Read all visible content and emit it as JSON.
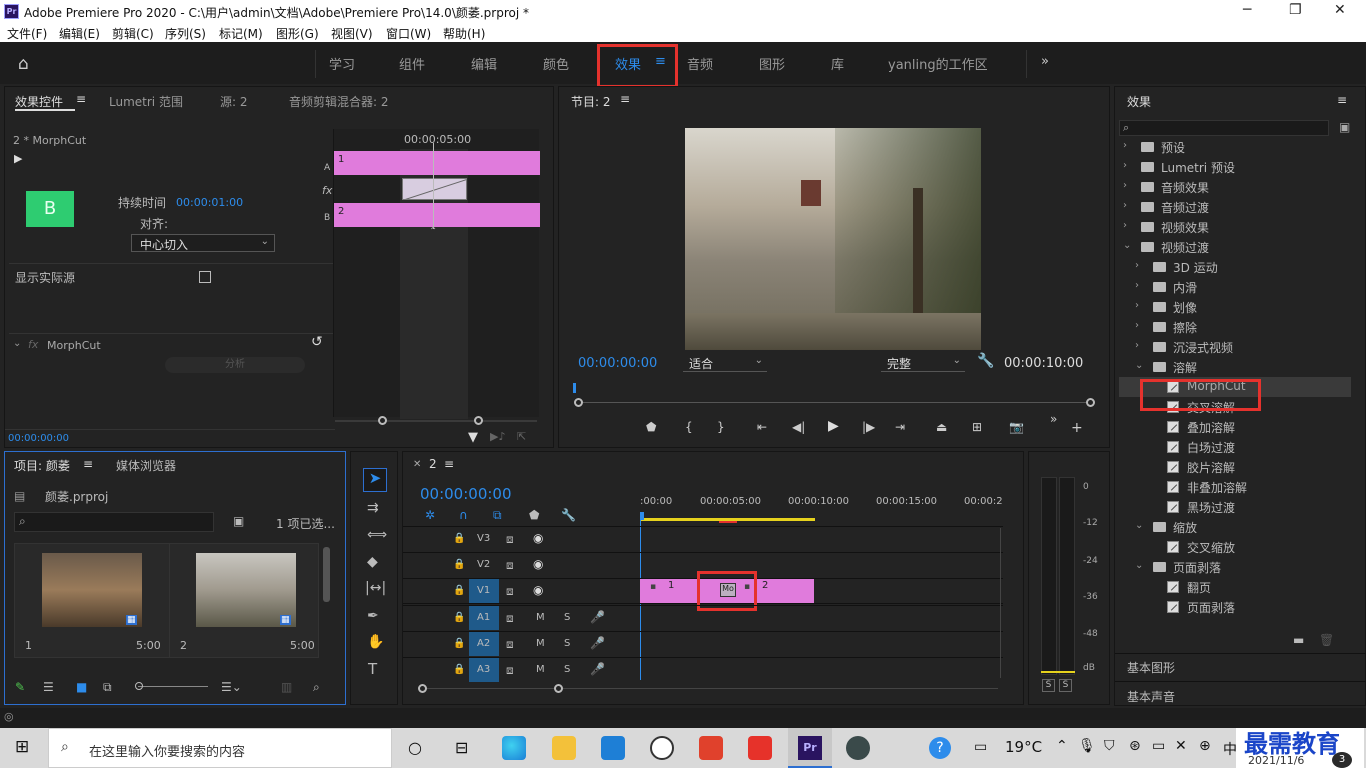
{
  "window": {
    "title": "Adobe Premiere Pro 2020 - C:\\用户\\admin\\文档\\Adobe\\Premiere Pro\\14.0\\颜萎.prproj *",
    "logo": "Pr"
  },
  "menu": [
    "文件(F)",
    "编辑(E)",
    "剪辑(C)",
    "序列(S)",
    "标记(M)",
    "图形(G)",
    "视图(V)",
    "窗口(W)",
    "帮助(H)"
  ],
  "workspaces": [
    "学习",
    "组件",
    "编辑",
    "颜色",
    "效果",
    "音频",
    "图形",
    "库",
    "yanling的工作区"
  ],
  "effect_controls": {
    "tabs": [
      "效果控件",
      "Lumetri 范围",
      "源: 2",
      "音频剪辑混合器: 2"
    ],
    "clip": "2 * MorphCut",
    "timecode_ruler": "00:00:05:00",
    "duration_label": "持续时间",
    "duration_value": "00:00:01:00",
    "align_label": "对齐:",
    "align_value": "中心切入",
    "show_source": "显示实际源",
    "effect_name": "MorphCut",
    "analyze": "分析",
    "track_a": "A",
    "track_b": "B",
    "clip_1": "1",
    "clip_2": "2",
    "fx": "fx",
    "current_time": "00:00:00:00",
    "thumb_letter": "B"
  },
  "program": {
    "title": "节目: 2",
    "timecode": "00:00:00:00",
    "fit": "适合",
    "quality": "完整",
    "duration": "00:00:10:00"
  },
  "effects_panel": {
    "title": "效果",
    "tree": [
      {
        "label": "预设",
        "level": 0,
        "type": "folder",
        "open": false
      },
      {
        "label": "Lumetri 预设",
        "level": 0,
        "type": "folder",
        "open": false
      },
      {
        "label": "音频效果",
        "level": 0,
        "type": "folder",
        "open": false
      },
      {
        "label": "音频过渡",
        "level": 0,
        "type": "folder",
        "open": false
      },
      {
        "label": "视频效果",
        "level": 0,
        "type": "folder",
        "open": false
      },
      {
        "label": "视频过渡",
        "level": 0,
        "type": "folder",
        "open": true
      },
      {
        "label": "3D 运动",
        "level": 1,
        "type": "folder",
        "open": false
      },
      {
        "label": "内滑",
        "level": 1,
        "type": "folder",
        "open": false
      },
      {
        "label": "划像",
        "level": 1,
        "type": "folder",
        "open": false
      },
      {
        "label": "擦除",
        "level": 1,
        "type": "folder",
        "open": false
      },
      {
        "label": "沉浸式视频",
        "level": 1,
        "type": "folder",
        "open": false
      },
      {
        "label": "溶解",
        "level": 1,
        "type": "folder",
        "open": true
      },
      {
        "label": "MorphCut",
        "level": 2,
        "type": "item",
        "selected": true
      },
      {
        "label": "交叉溶解",
        "level": 2,
        "type": "item"
      },
      {
        "label": "叠加溶解",
        "level": 2,
        "type": "item"
      },
      {
        "label": "白场过渡",
        "level": 2,
        "type": "item"
      },
      {
        "label": "胶片溶解",
        "level": 2,
        "type": "item"
      },
      {
        "label": "非叠加溶解",
        "level": 2,
        "type": "item"
      },
      {
        "label": "黑场过渡",
        "level": 2,
        "type": "item"
      },
      {
        "label": "缩放",
        "level": 1,
        "type": "folder",
        "open": true
      },
      {
        "label": "交叉缩放",
        "level": 2,
        "type": "item"
      },
      {
        "label": "页面剥落",
        "level": 1,
        "type": "folder",
        "open": true
      },
      {
        "label": "翻页",
        "level": 2,
        "type": "item"
      },
      {
        "label": "页面剥落",
        "level": 2,
        "type": "item"
      }
    ],
    "basic_graphics": "基本图形",
    "basic_sound": "基本声音"
  },
  "project": {
    "tabs": [
      "项目: 颜萎",
      "媒体浏览器"
    ],
    "file": "颜萎.prproj",
    "selection": "1 项已选...",
    "items": [
      {
        "name": "1",
        "duration": "5:00"
      },
      {
        "name": "2",
        "duration": "5:00"
      }
    ]
  },
  "timeline": {
    "tab": "2",
    "timecode": "00:00:00:00",
    "ruler": [
      ":00:00",
      "00:00:05:00",
      "00:00:10:00",
      "00:00:15:00",
      "00:00:2"
    ],
    "video_tracks": [
      "V3",
      "V2",
      "V1"
    ],
    "audio_tracks": [
      "A1",
      "A2",
      "A3"
    ],
    "clip1": "1",
    "clip2": "2",
    "transition": "Mo",
    "m": "M",
    "s": "S"
  },
  "meter": {
    "labels": [
      "0",
      "-12",
      "-24",
      "-36",
      "-48",
      "dB"
    ],
    "solo": "S"
  },
  "taskbar": {
    "search": "在这里输入你要搜索的内容",
    "weather": "19°C",
    "ime": "中",
    "date": "2021/11/6",
    "badge": "3",
    "watermark": "最需教育"
  },
  "colors": {
    "accent": "#2d8ceb",
    "clip": "#e07bdc",
    "highlight": "#e5322d",
    "transition_thumb": "#2ecc71"
  }
}
